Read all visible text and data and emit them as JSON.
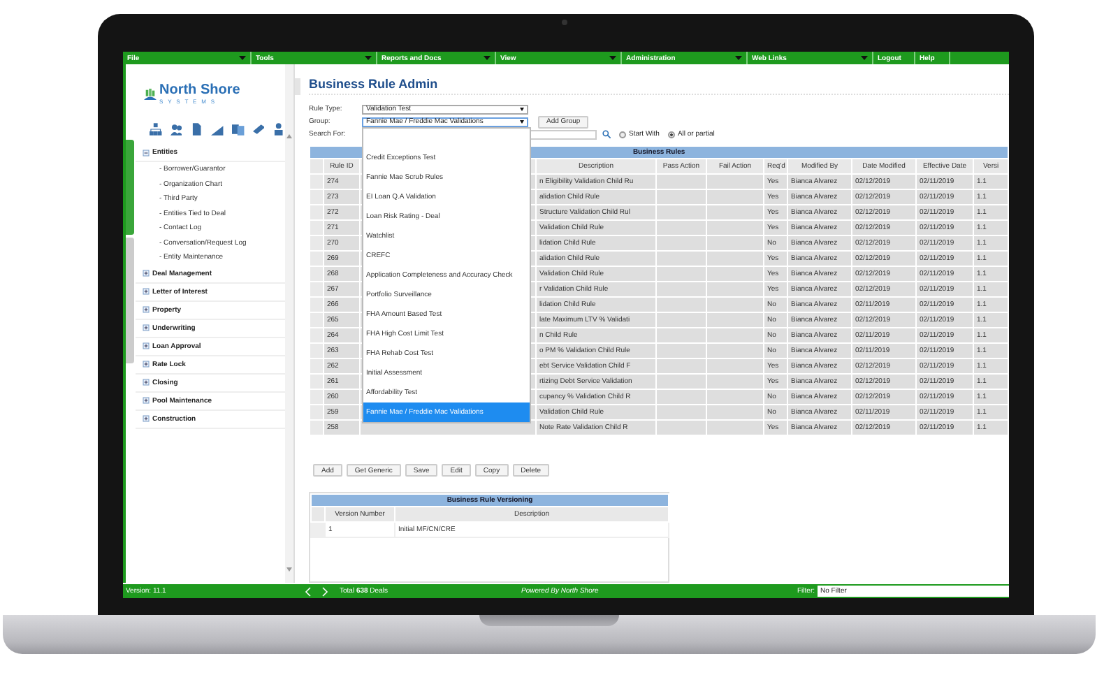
{
  "menu": [
    {
      "label": "File",
      "dropdown": true
    },
    {
      "label": "Tools",
      "dropdown": true
    },
    {
      "label": "Reports and Docs",
      "dropdown": true
    },
    {
      "label": "View",
      "dropdown": true
    },
    {
      "label": "Administration",
      "dropdown": true
    },
    {
      "label": "Web Links",
      "dropdown": true
    },
    {
      "label": "Logout",
      "dropdown": false
    },
    {
      "label": "Help",
      "dropdown": false
    }
  ],
  "logo": {
    "name": "North Shore",
    "tagline": "SYSTEMS"
  },
  "sidebar": {
    "items": [
      {
        "label": "Entities",
        "expanded": true,
        "children": [
          {
            "label": "- Borrower/Guarantor"
          },
          {
            "label": "- Organization Chart"
          },
          {
            "label": "- Third Party"
          },
          {
            "label": "- Entities Tied to Deal"
          },
          {
            "label": "- Contact Log"
          },
          {
            "label": "- Conversation/Request Log"
          },
          {
            "label": "- Entity Maintenance"
          }
        ]
      },
      {
        "label": "Deal Management",
        "expanded": false
      },
      {
        "label": "Letter of Interest",
        "expanded": false
      },
      {
        "label": "Property",
        "expanded": false
      },
      {
        "label": "Underwriting",
        "expanded": false
      },
      {
        "label": "Loan Approval",
        "expanded": false
      },
      {
        "label": "Rate Lock",
        "expanded": false
      },
      {
        "label": "Closing",
        "expanded": false
      },
      {
        "label": "Pool Maintenance",
        "expanded": false
      },
      {
        "label": "Construction",
        "expanded": false
      }
    ]
  },
  "page_title": "Business Rule Admin",
  "filters": {
    "rule_type": {
      "label": "Rule Type:",
      "value": "Validation Test"
    },
    "group": {
      "label": "Group:",
      "value": "Fannie Mae / Freddie Mac Validations",
      "open": true,
      "options": [
        {
          "label": "Credit Exceptions Test",
          "selected": false
        },
        {
          "label": "Fannie Mae Scrub Rules",
          "selected": false
        },
        {
          "label": "EI Loan Q.A Validation",
          "selected": false
        },
        {
          "label": "Loan Risk Rating - Deal",
          "selected": false
        },
        {
          "label": "Watchlist",
          "selected": false
        },
        {
          "label": "CREFC",
          "selected": false
        },
        {
          "label": "Application Completeness and Accuracy Check",
          "selected": false
        },
        {
          "label": "Portfolio Surveillance",
          "selected": false
        },
        {
          "label": "FHA Amount Based Test",
          "selected": false
        },
        {
          "label": "FHA High Cost Limit Test",
          "selected": false
        },
        {
          "label": "FHA Rehab Cost Test",
          "selected": false
        },
        {
          "label": "Initial Assessment",
          "selected": false
        },
        {
          "label": "Affordability Test",
          "selected": false
        },
        {
          "label": "Fannie Mae / Freddie Mac Validations",
          "selected": true
        }
      ]
    },
    "add_group": "Add Group",
    "search": {
      "label": "Search For:"
    },
    "radios": [
      {
        "label": "Start With",
        "selected": false
      },
      {
        "label": "All or partial",
        "selected": true
      }
    ]
  },
  "rules_table": {
    "title": "Business Rules",
    "columns": [
      "Rule ID",
      "",
      "Description",
      "Pass Action",
      "Fail Action",
      "Req'd",
      "Modified By",
      "Date Modified",
      "Effective Date",
      "Versi"
    ],
    "rows": [
      {
        "rule_id": "274",
        "description": "n Eligibility Validation Child Ru",
        "required": "Yes",
        "modified_by": "Bianca Alvarez",
        "date_modified": "02/12/2019",
        "effective_date": "02/11/2019",
        "version": "1.1"
      },
      {
        "rule_id": "273",
        "description": "alidation Child Rule",
        "required": "Yes",
        "modified_by": "Bianca Alvarez",
        "date_modified": "02/12/2019",
        "effective_date": "02/11/2019",
        "version": "1.1"
      },
      {
        "rule_id": "272",
        "description": "Structure Validation Child Rul",
        "required": "Yes",
        "modified_by": "Bianca Alvarez",
        "date_modified": "02/12/2019",
        "effective_date": "02/11/2019",
        "version": "1.1"
      },
      {
        "rule_id": "271",
        "description": "Validation Child Rule",
        "required": "Yes",
        "modified_by": "Bianca Alvarez",
        "date_modified": "02/12/2019",
        "effective_date": "02/11/2019",
        "version": "1.1"
      },
      {
        "rule_id": "270",
        "description": "lidation Child Rule",
        "required": "No",
        "modified_by": "Bianca Alvarez",
        "date_modified": "02/12/2019",
        "effective_date": "02/11/2019",
        "version": "1.1"
      },
      {
        "rule_id": "269",
        "description": "alidation Child Rule",
        "required": "Yes",
        "modified_by": "Bianca Alvarez",
        "date_modified": "02/12/2019",
        "effective_date": "02/11/2019",
        "version": "1.1"
      },
      {
        "rule_id": "268",
        "description": "Validation Child Rule",
        "required": "Yes",
        "modified_by": "Bianca Alvarez",
        "date_modified": "02/12/2019",
        "effective_date": "02/11/2019",
        "version": "1.1"
      },
      {
        "rule_id": "267",
        "description": "r Validation Child Rule",
        "required": "Yes",
        "modified_by": "Bianca Alvarez",
        "date_modified": "02/12/2019",
        "effective_date": "02/11/2019",
        "version": "1.1"
      },
      {
        "rule_id": "266",
        "description": "lidation Child Rule",
        "required": "No",
        "modified_by": "Bianca Alvarez",
        "date_modified": "02/11/2019",
        "effective_date": "02/11/2019",
        "version": "1.1"
      },
      {
        "rule_id": "265",
        "description": "late Maximum LTV % Validati",
        "required": "No",
        "modified_by": "Bianca Alvarez",
        "date_modified": "02/12/2019",
        "effective_date": "02/11/2019",
        "version": "1.1"
      },
      {
        "rule_id": "264",
        "description": "n Child Rule",
        "required": "No",
        "modified_by": "Bianca Alvarez",
        "date_modified": "02/11/2019",
        "effective_date": "02/11/2019",
        "version": "1.1"
      },
      {
        "rule_id": "263",
        "description": "o PM % Validation Child Rule",
        "required": "No",
        "modified_by": "Bianca Alvarez",
        "date_modified": "02/11/2019",
        "effective_date": "02/11/2019",
        "version": "1.1"
      },
      {
        "rule_id": "262",
        "description": "ebt Service Validation Child F",
        "required": "Yes",
        "modified_by": "Bianca Alvarez",
        "date_modified": "02/12/2019",
        "effective_date": "02/11/2019",
        "version": "1.1"
      },
      {
        "rule_id": "261",
        "description": "rtizing Debt Service Validation",
        "required": "Yes",
        "modified_by": "Bianca Alvarez",
        "date_modified": "02/12/2019",
        "effective_date": "02/11/2019",
        "version": "1.1"
      },
      {
        "rule_id": "260",
        "description": "cupancy % Validation Child R",
        "required": "No",
        "modified_by": "Bianca Alvarez",
        "date_modified": "02/12/2019",
        "effective_date": "02/11/2019",
        "version": "1.1"
      },
      {
        "rule_id": "259",
        "description": "Validation Child Rule",
        "required": "No",
        "modified_by": "Bianca Alvarez",
        "date_modified": "02/11/2019",
        "effective_date": "02/11/2019",
        "version": "1.1"
      },
      {
        "rule_id": "258",
        "description": "Note Rate Validation Child R",
        "required": "Yes",
        "modified_by": "Bianca Alvarez",
        "date_modified": "02/12/2019",
        "effective_date": "02/11/2019",
        "version": "1.1"
      }
    ]
  },
  "buttons": [
    "Add",
    "Get Generic",
    "Save",
    "Edit",
    "Copy",
    "Delete"
  ],
  "versioning": {
    "title": "Business Rule Versioning",
    "columns": [
      "Version Number",
      "Description"
    ],
    "rows": [
      {
        "version": "1",
        "description": "Initial MF/CN/CRE"
      }
    ]
  },
  "status_bar": {
    "version": "Version: 11.1",
    "total": "Total **638** Deals",
    "powered_by": "Powered By North Shore",
    "filter_label": "Filter:",
    "filter_value": "No Filter"
  }
}
